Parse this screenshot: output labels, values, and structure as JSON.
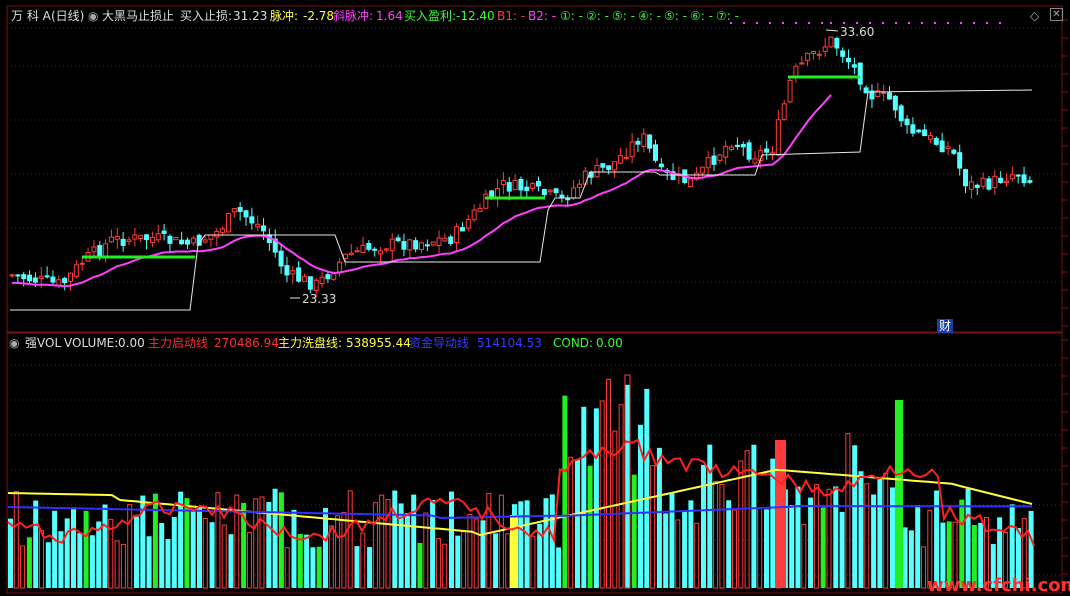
{
  "top_panel": {
    "stock_name": "万 科 A",
    "period": "(日线)",
    "indicator_name": "大黑马止损止",
    "buy_stop_label": "买入止损:",
    "buy_stop_value": "31.23",
    "pulse_label": "脉冲:",
    "pulse_value": "-2.78",
    "slant_pulse_label": "斜脉冲:",
    "slant_pulse_value": "1.64",
    "buy_profit_label": "买入盈利:",
    "buy_profit_value": "-12.40",
    "b1": "B1: -",
    "b2": "B2: -",
    "markers": [
      "①: -",
      "②: -",
      "⑤: -",
      "④: -",
      "⑤: -",
      "⑥: -",
      "⑦: -"
    ],
    "high_label": "33.60",
    "low_label": "23.33",
    "fin_tag": "财"
  },
  "bottom_panel": {
    "indicator_name": "强VOL",
    "volume_label": "VOLUME:",
    "volume_value": "0.00",
    "start_line_label": "主力启动线",
    "start_line_value": "270486.94",
    "wash_line_label": "主力洗盘线:",
    "wash_line_value": "538955.44",
    "capital_line_label": "资金导动线",
    "capital_line_value": "514104.53",
    "cond_label": "COND:",
    "cond_value": "0.00",
    "watermark": "www.cfchi.com"
  },
  "colors": {
    "up": "#ff3c3c",
    "down": "#54ffff",
    "green": "#22ee22",
    "magenta": "#ff40ff",
    "white": "#e8e8e8",
    "yellow": "#ffff3c",
    "blue": "#3030ff",
    "red_line": "#ff2020",
    "grid": "#7a1010"
  },
  "chart_data": {
    "type": "candlestick",
    "price_axis": {
      "high": 33.6,
      "low": 23.33
    },
    "volume_axis_max": 1000000
  }
}
